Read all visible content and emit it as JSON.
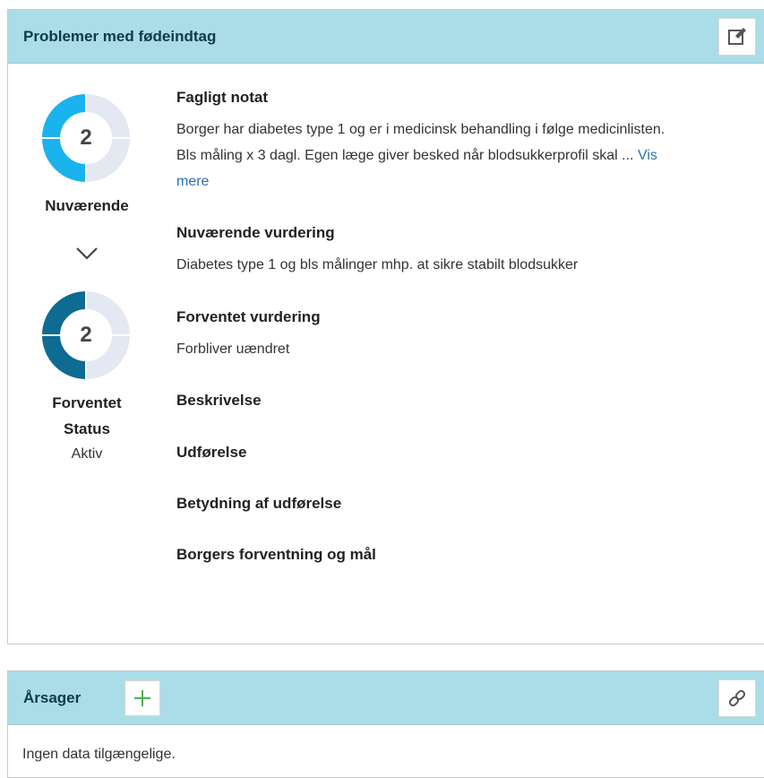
{
  "problem_panel": {
    "title": "Problemer med fødeindtag",
    "edit_icon": "edit-pencil-icon",
    "current": {
      "value": "2",
      "label": "Nuværende",
      "color": "#1ab3ee",
      "fraction": 0.5
    },
    "expected": {
      "value": "2",
      "label": "Forventet",
      "color": "#0e6b91",
      "fraction": 0.5
    },
    "status_label": "Status",
    "status_value": "Aktiv",
    "sections": {
      "fagligt_notat_title": "Fagligt notat",
      "fagligt_notat_text": "Borger har diabetes type 1 og er i medicinsk behandling i følge medicinlisten. Bls måling x 3 dagl. Egen læge giver besked når blodsukkerprofil skal ... ",
      "vis_mere": "Vis mere",
      "nuvaerende_vurdering_title": "Nuværende vurdering",
      "nuvaerende_vurdering_text": "Diabetes type 1 og bls målinger mhp. at sikre stabilt blodsukker",
      "forventet_vurdering_title": "Forventet vurdering",
      "forventet_vurdering_text": "Forbliver uændret",
      "beskrivelse_title": "Beskrivelse",
      "udfoerelse_title": "Udførelse",
      "betydning_title": "Betydning af udførelse",
      "borgers_title": "Borgers forventning og mål"
    }
  },
  "aarsager_panel": {
    "title": "Årsager",
    "add_icon": "plus-icon",
    "link_icon": "link-icon",
    "empty_text": "Ingen data tilgængelige."
  },
  "colors": {
    "header_bg": "#aadde8",
    "donut_track": "#e3e8f2",
    "link": "#2b6fb3",
    "add_green": "#4caf50"
  }
}
